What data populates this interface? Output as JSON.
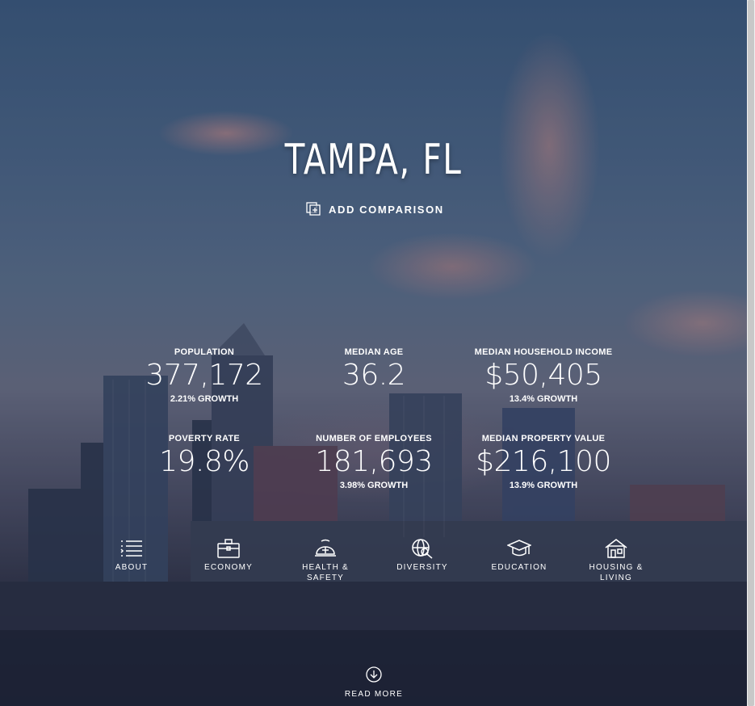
{
  "city": {
    "title": "TAMPA, FL"
  },
  "actions": {
    "add_comparison": "ADD COMPARISON"
  },
  "stats": [
    {
      "label": "POPULATION",
      "value": "377,172",
      "growth": "2.21% GROWTH"
    },
    {
      "label": "MEDIAN AGE",
      "value": "36.2",
      "growth": ""
    },
    {
      "label": "MEDIAN HOUSEHOLD INCOME",
      "value": "$50,405",
      "growth": "13.4% GROWTH"
    },
    {
      "label": "POVERTY RATE",
      "value": "19.8%",
      "growth": ""
    },
    {
      "label": "NUMBER OF EMPLOYEES",
      "value": "181,693",
      "growth": "3.98% GROWTH"
    },
    {
      "label": "MEDIAN PROPERTY VALUE",
      "value": "$216,100",
      "growth": "13.9% GROWTH"
    }
  ],
  "nav": [
    {
      "label": "ABOUT",
      "icon": "list-icon"
    },
    {
      "label": "ECONOMY",
      "icon": "briefcase-icon"
    },
    {
      "label": "HEALTH & SAFETY",
      "icon": "helmet-icon"
    },
    {
      "label": "DIVERSITY",
      "icon": "globe-search-icon"
    },
    {
      "label": "EDUCATION",
      "icon": "graduation-cap-icon"
    },
    {
      "label_line1": "HOUSING &",
      "label_line2": "LIVING",
      "icon": "house-icon"
    }
  ],
  "footer": {
    "read_more": "READ MORE"
  },
  "colors": {
    "text": "#ffffff",
    "sky_top": "#3b5a7f",
    "sky_bottom": "#1c2134"
  }
}
